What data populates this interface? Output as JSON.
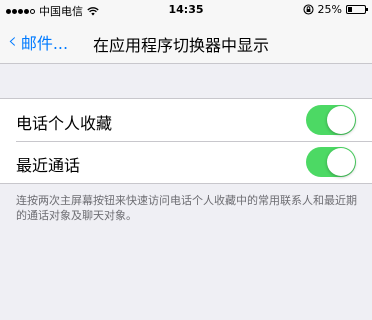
{
  "status_bar": {
    "carrier": "中国电信",
    "time": "14:35",
    "battery_percent": "25%",
    "battery_level": 0.25,
    "icons": [
      "signal-icon",
      "wifi-icon",
      "rotation-lock-icon",
      "battery-icon"
    ]
  },
  "nav": {
    "back_label": "邮件...",
    "title": "在应用程序切换器中显示"
  },
  "settings": {
    "rows": [
      {
        "label": "电话个人收藏",
        "enabled": true
      },
      {
        "label": "最近通话",
        "enabled": true
      }
    ],
    "footer": "连按两次主屏幕按钮来快速访问电话个人收藏中的常用联系人和最近期的通话对象及聊天对象。"
  },
  "colors": {
    "accent": "#007aff",
    "toggle_on": "#4cd964",
    "background": "#efeff4"
  }
}
